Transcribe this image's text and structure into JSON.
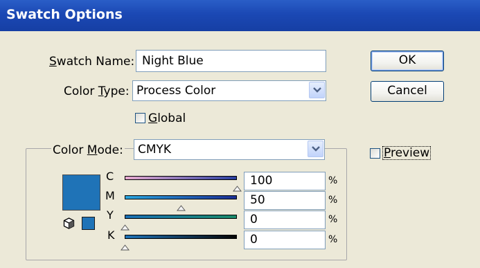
{
  "window": {
    "title": "Swatch Options"
  },
  "swatch_name": {
    "label_prefix": "S",
    "label_rest": "watch Name:",
    "value": "Night Blue"
  },
  "color_type": {
    "label_pre": "Color ",
    "label_ul": "T",
    "label_post": "ype:",
    "value": "Process Color"
  },
  "global": {
    "label_ul": "G",
    "label_rest": "lobal",
    "checked": false
  },
  "color_mode": {
    "label_pre": "Color ",
    "label_ul": "M",
    "label_post": "ode:",
    "value": "CMYK"
  },
  "buttons": {
    "ok": "OK",
    "cancel": "Cancel"
  },
  "preview": {
    "label_ul": "P",
    "label_rest": "review",
    "checked": false
  },
  "swatch_color": "#1f73b7",
  "channels": [
    {
      "letter": "C",
      "value": "100",
      "unit": "%",
      "level": 1.0
    },
    {
      "letter": "M",
      "value": "50",
      "unit": "%",
      "level": 0.5
    },
    {
      "letter": "Y",
      "value": "0",
      "unit": "%",
      "level": 0.0
    },
    {
      "letter": "K",
      "value": "0",
      "unit": "%",
      "level": 0.0
    }
  ]
}
